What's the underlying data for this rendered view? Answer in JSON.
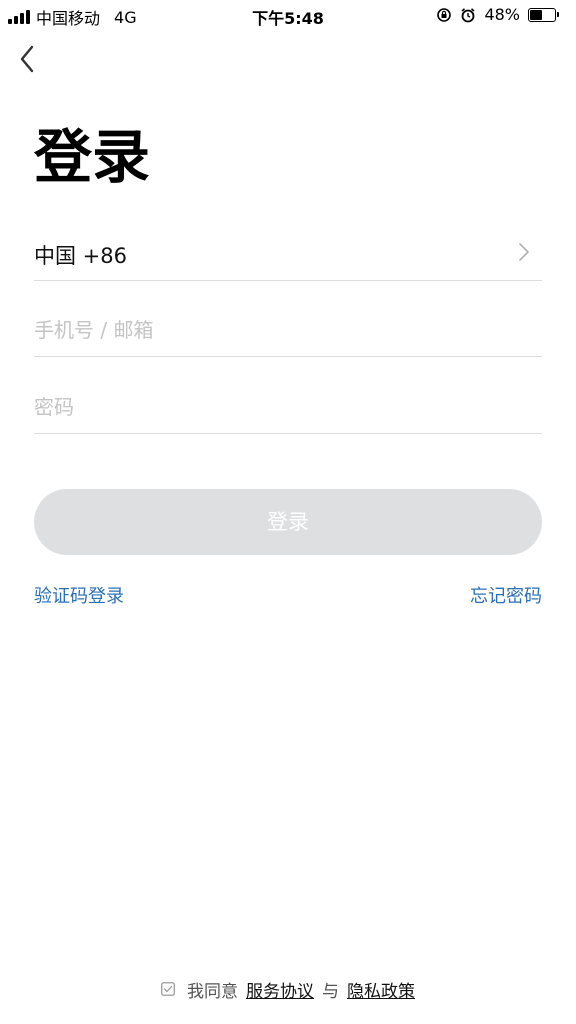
{
  "status_bar": {
    "carrier": "中国移动",
    "network": "4G",
    "time": "下午5:48",
    "battery_percent": "48%",
    "battery_level": 0.48,
    "icons": [
      "signal-icon",
      "orientation-lock-icon",
      "alarm-icon",
      "battery-icon"
    ]
  },
  "nav": {
    "back_icon": "chevron-left-icon"
  },
  "page": {
    "title": "登录"
  },
  "form": {
    "country": {
      "label": "中国 +86",
      "icon": "chevron-right-icon"
    },
    "account": {
      "placeholder": "手机号 / 邮箱",
      "value": ""
    },
    "password": {
      "placeholder": "密码",
      "value": ""
    },
    "submit_label": "登录"
  },
  "links": {
    "sms_login": "验证码登录",
    "forgot_password": "忘记密码"
  },
  "footer": {
    "checkbox_icon": "checkbox-icon",
    "agree_prefix": "我同意",
    "service_agreement": "服务协议",
    "conjunction": "与",
    "privacy_policy": "隐私政策"
  },
  "colors": {
    "link": "#2b6fb6",
    "button_disabled": "#dedfe1",
    "divider": "#dddddd",
    "placeholder": "#c4c4c4"
  }
}
